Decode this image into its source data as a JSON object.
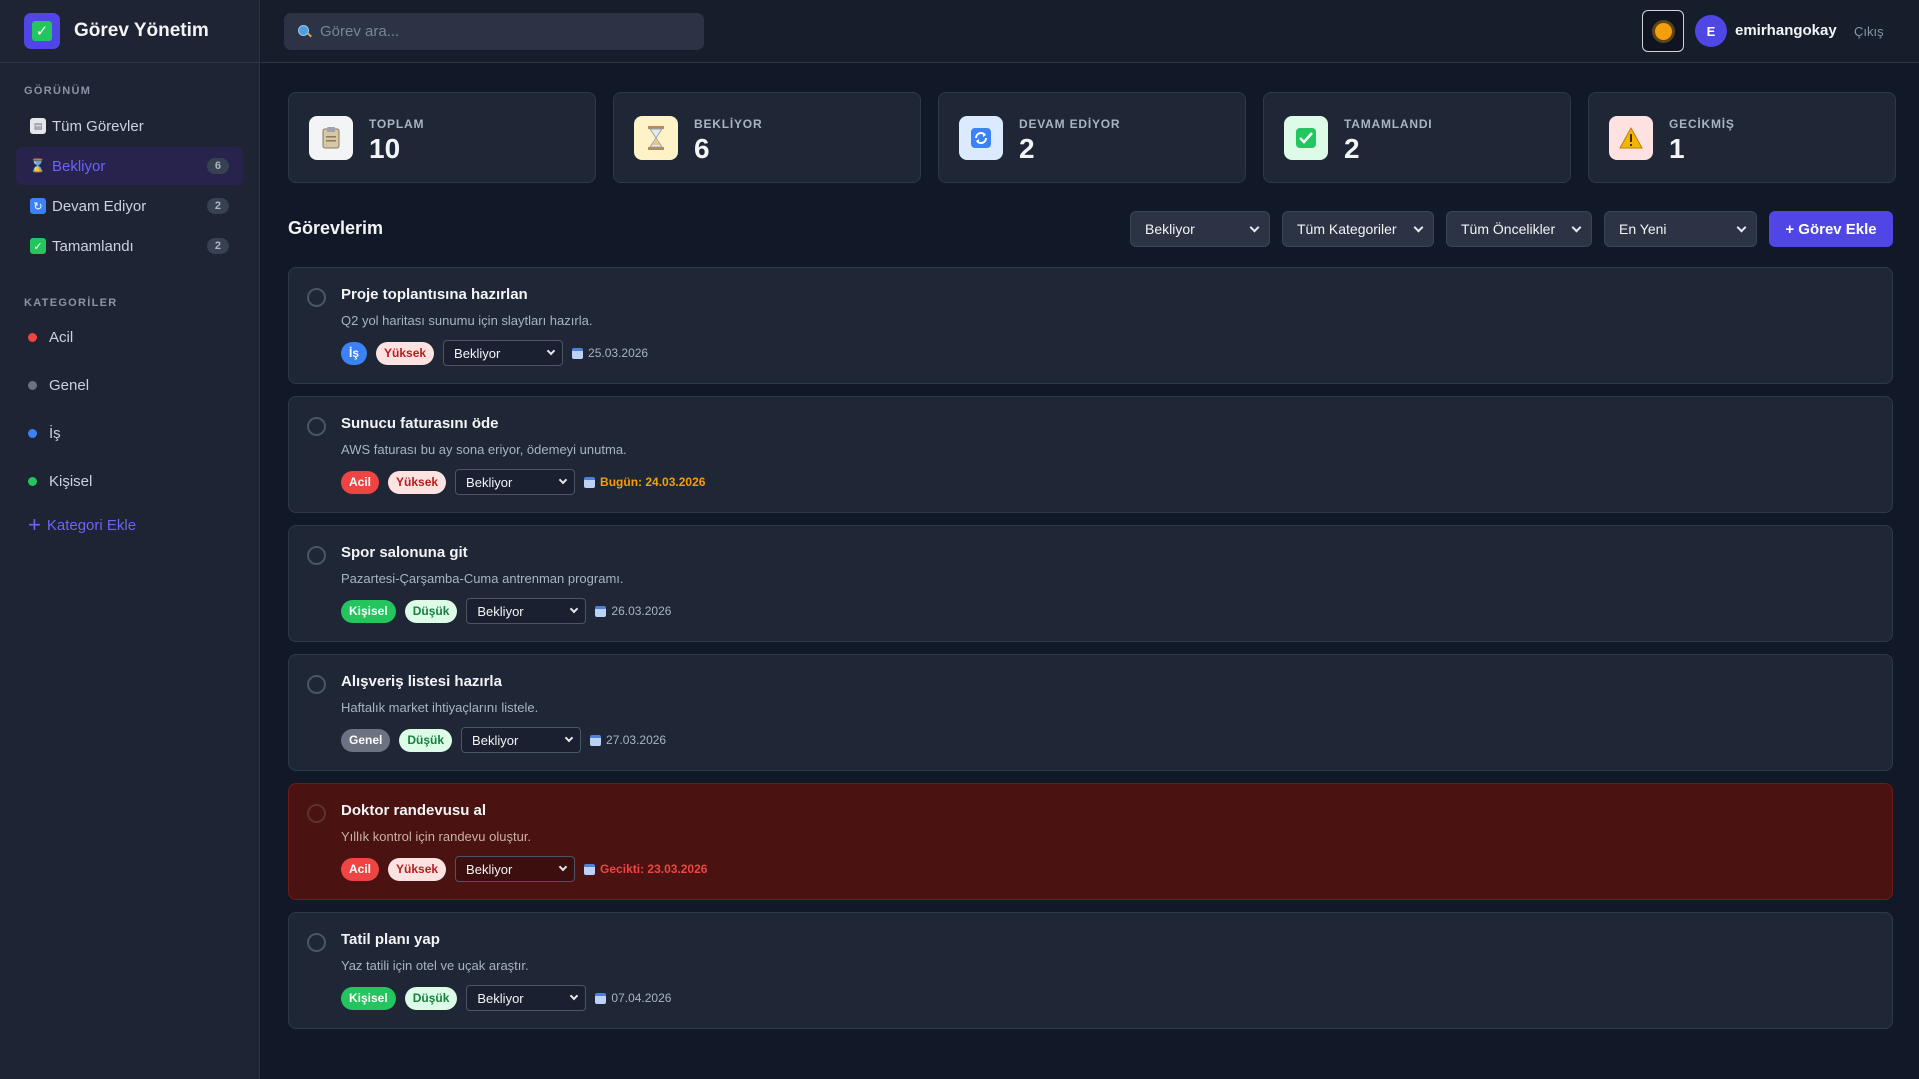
{
  "app": {
    "title": "Görev Yönetim"
  },
  "sidebar": {
    "view_label": "GÖRÜNÜM",
    "views": [
      {
        "label": "Tüm Görevler",
        "count": "",
        "icon": "clipboard-icon"
      },
      {
        "label": "Bekliyor",
        "count": "6",
        "icon": "hourglass-icon"
      },
      {
        "label": "Devam Ediyor",
        "count": "2",
        "icon": "refresh-icon"
      },
      {
        "label": "Tamamlandı",
        "count": "2",
        "icon": "check-icon"
      }
    ],
    "categories_label": "KATEGORİLER",
    "categories": [
      {
        "label": "Acil",
        "color": "#ef4444"
      },
      {
        "label": "Genel",
        "color": "#6b7280"
      },
      {
        "label": "İş",
        "color": "#3b82f6"
      },
      {
        "label": "Kişisel",
        "color": "#22c55e"
      }
    ],
    "add_category": "Kategori Ekle"
  },
  "header": {
    "search_placeholder": "Görev ara...",
    "avatar_initial": "E",
    "username": "emirhangokay",
    "logout": "Çıkış"
  },
  "stats": [
    {
      "label": "TOPLAM",
      "value": "10",
      "icon": "clipboard-icon",
      "bg": "#f3f4f6"
    },
    {
      "label": "BEKLİYOR",
      "value": "6",
      "icon": "hourglass-icon",
      "bg": "#fef3c7"
    },
    {
      "label": "DEVAM EDİYOR",
      "value": "2",
      "icon": "refresh-icon",
      "bg": "#dbeafe"
    },
    {
      "label": "TAMAMLANDI",
      "value": "2",
      "icon": "check-icon",
      "bg": "#dcfce7"
    },
    {
      "label": "GECİKMİŞ",
      "value": "1",
      "icon": "warning-icon",
      "bg": "#fee2e2"
    }
  ],
  "toolbar": {
    "title": "Görevlerim",
    "status_filter": "Bekliyor",
    "category_filter": "Tüm Kategoriler",
    "priority_filter": "Tüm Öncelikler",
    "sort": "En Yeni",
    "add_button": "+ Görev Ekle"
  },
  "tasks": [
    {
      "title": "Proje toplantısına hazırlan",
      "desc": "Q2 yol haritası sunumu için slaytları hazırla.",
      "category": "İş",
      "priority": "Yüksek",
      "status": "Bekliyor",
      "date": "25.03.2026",
      "state": "normal"
    },
    {
      "title": "Sunucu faturasını öde",
      "desc": "AWS faturası bu ay sona eriyor, ödemeyi unutma.",
      "category": "Acil",
      "priority": "Yüksek",
      "status": "Bekliyor",
      "date": "Bugün: 24.03.2026",
      "state": "today"
    },
    {
      "title": "Spor salonuna git",
      "desc": "Pazartesi-Çarşamba-Cuma antrenman programı.",
      "category": "Kişisel",
      "priority": "Düşük",
      "status": "Bekliyor",
      "date": "26.03.2026",
      "state": "normal"
    },
    {
      "title": "Alışveriş listesi hazırla",
      "desc": "Haftalık market ihtiyaçlarını listele.",
      "category": "Genel",
      "priority": "Düşük",
      "status": "Bekliyor",
      "date": "27.03.2026",
      "state": "normal"
    },
    {
      "title": "Doktor randevusu al",
      "desc": "Yıllık kontrol için randevu oluştur.",
      "category": "Acil",
      "priority": "Yüksek",
      "status": "Bekliyor",
      "date": "Gecikti: 23.03.2026",
      "state": "overdue"
    },
    {
      "title": "Tatil planı yap",
      "desc": "Yaz tatili için otel ve uçak araştır.",
      "category": "Kişisel",
      "priority": "Düşük",
      "status": "Bekliyor",
      "date": "07.04.2026",
      "state": "normal"
    }
  ]
}
